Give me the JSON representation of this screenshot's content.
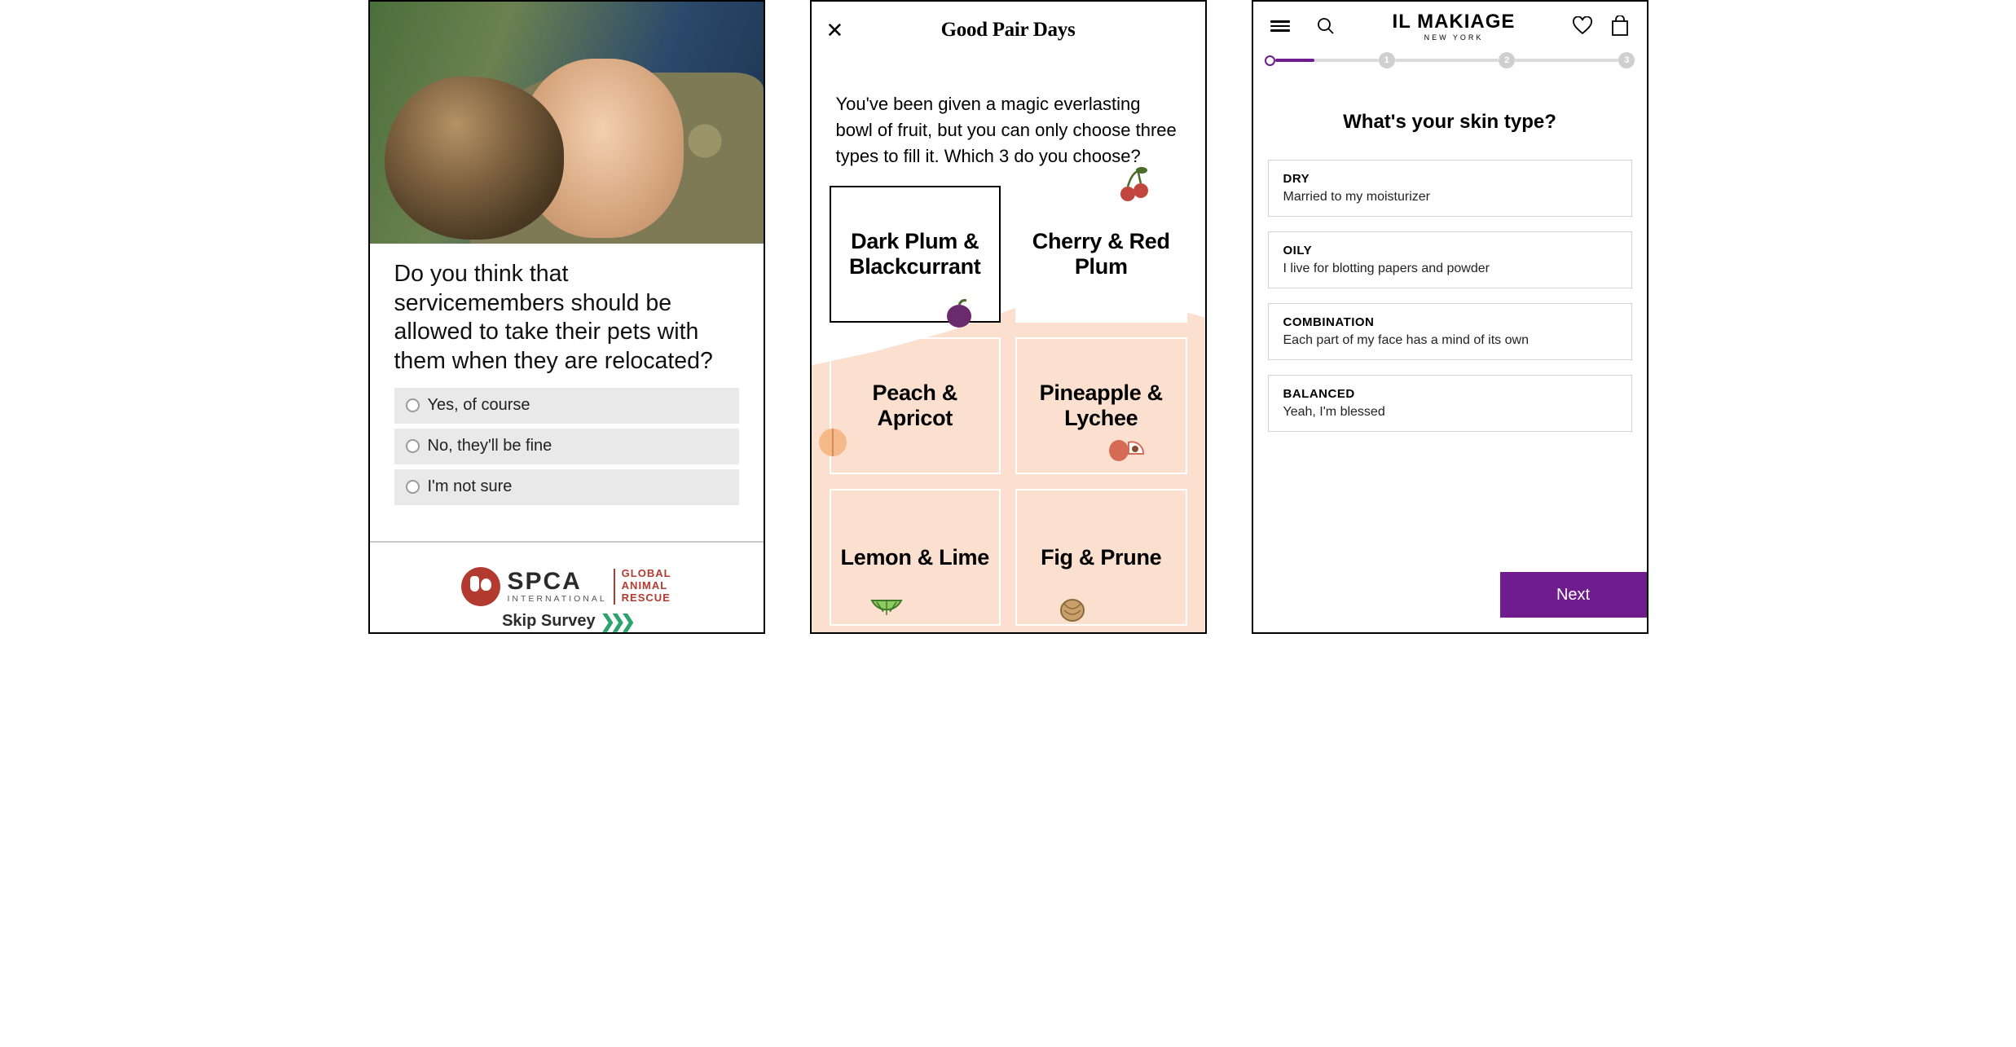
{
  "screen1": {
    "question": "Do you think that servicemembers should be allowed to take their pets with them when they are relocated?",
    "options": [
      "Yes, of course",
      "No, they'll be fine",
      "I'm not sure"
    ],
    "brand_big": "SPCA",
    "brand_small": "INTERNATIONAL",
    "brand_side_l1": "GLOBAL",
    "brand_side_l2": "ANIMAL",
    "brand_side_l3": "RESCUE",
    "skip": "Skip Survey"
  },
  "screen2": {
    "logo": "Good Pair Days",
    "question": "You've been given a magic everlasting bowl of fruit, but you can only choose three types to fill it. Which 3 do you choose?",
    "cards": [
      "Dark Plum & Blackcurrant",
      "Cherry & Red Plum",
      "Peach & Apricot",
      "Pineapple & Lychee",
      "Lemon & Lime",
      "Fig & Prune"
    ]
  },
  "screen3": {
    "brand": "IL MAKIAGE",
    "brand_sub": "NEW YORK",
    "steps": [
      "1",
      "2",
      "3"
    ],
    "question": "What's your skin type?",
    "options": [
      {
        "t": "DRY",
        "s": "Married to my moisturizer"
      },
      {
        "t": "OILY",
        "s": "I live for blotting papers and powder"
      },
      {
        "t": "COMBINATION",
        "s": "Each part of my face has a mind of its own"
      },
      {
        "t": "BALANCED",
        "s": "Yeah, I'm blessed"
      }
    ],
    "next": "Next"
  }
}
